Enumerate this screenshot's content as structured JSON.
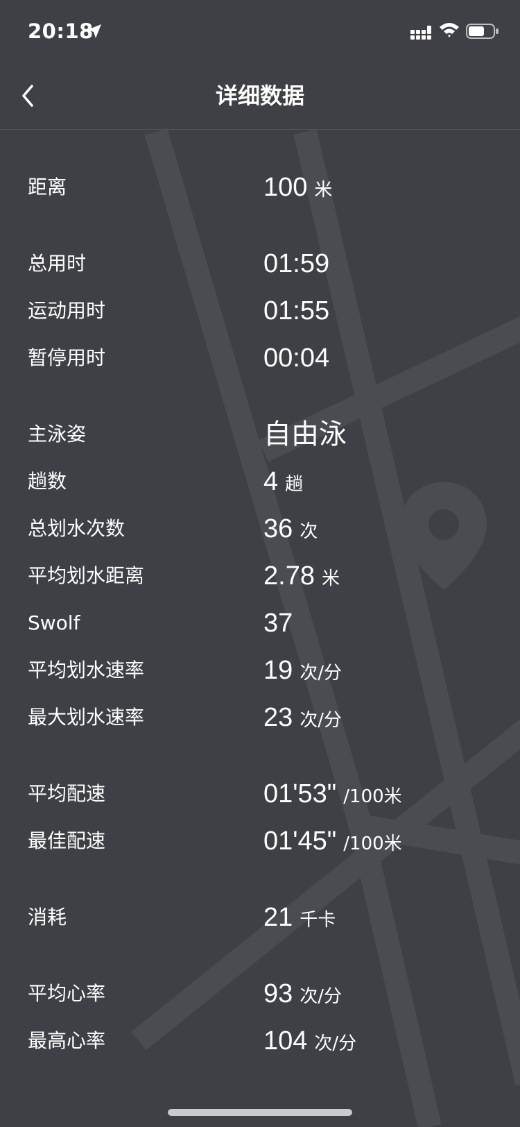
{
  "status_bar": {
    "time": "20:18",
    "icons": [
      "location-arrow-icon",
      "signal-icon",
      "wifi-icon",
      "battery-icon"
    ]
  },
  "header": {
    "title": "详细数据",
    "back_icon": "chevron-left-icon"
  },
  "rows": [
    {
      "label": "距离",
      "value": "100",
      "unit": "米"
    },
    {
      "label": "总用时",
      "value": "01:59",
      "unit": ""
    },
    {
      "label": "运动用时",
      "value": "01:55",
      "unit": ""
    },
    {
      "label": "暂停用时",
      "value": "00:04",
      "unit": ""
    },
    {
      "label": "主泳姿",
      "value": "自由泳",
      "unit": ""
    },
    {
      "label": "趟数",
      "value": "4",
      "unit": "趟"
    },
    {
      "label": "总划水次数",
      "value": "36",
      "unit": "次"
    },
    {
      "label": "平均划水距离",
      "value": "2.78",
      "unit": "米"
    },
    {
      "label": "Swolf",
      "value": "37",
      "unit": ""
    },
    {
      "label": "平均划水速率",
      "value": "19",
      "unit": "次/分"
    },
    {
      "label": "最大划水速率",
      "value": "23",
      "unit": "次/分"
    },
    {
      "label": "平均配速",
      "value": "01'53\"",
      "unit": "/100米"
    },
    {
      "label": "最佳配速",
      "value": "01'45\"",
      "unit": "/100米"
    },
    {
      "label": "消耗",
      "value": "21",
      "unit": "千卡"
    },
    {
      "label": "平均心率",
      "value": "93",
      "unit": "次/分"
    },
    {
      "label": "最高心率",
      "value": "104",
      "unit": "次/分"
    }
  ],
  "background": {
    "icon": "map-pin-icon",
    "color": "#3e4045"
  }
}
